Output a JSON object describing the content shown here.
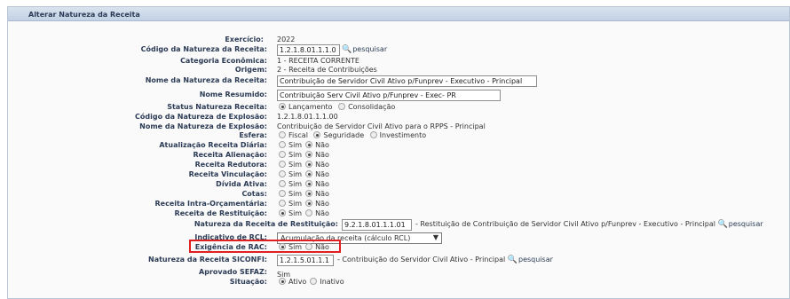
{
  "header": {
    "title": "Alterar Natureza da Receita"
  },
  "fields": {
    "exercicio": {
      "label": "Exercício:",
      "value": "2022"
    },
    "codigo": {
      "label": "Código da Natureza da Receita:",
      "value": "1.2.1.8.01.1.1.0",
      "search": "pesquisar"
    },
    "categoria": {
      "label": "Categoria Econômica:",
      "value": "1 -  RECEITA CORRENTE"
    },
    "origem": {
      "label": "Origem:",
      "value": "2 -  Receita de Contribuições"
    },
    "nome": {
      "label": "Nome da Natureza da Receita:",
      "value": "Contribuição de Servidor Civil Ativo p/Funprev - Executivo - Principal"
    },
    "nome_resumido": {
      "label": "Nome Resumido:",
      "value": "Contribuição Serv Civil Ativo p/Funprev - Exec- PR"
    },
    "status": {
      "label": "Status Natureza Receita:",
      "options": [
        "Lançamento",
        "Consolidação"
      ]
    },
    "cod_explosao": {
      "label": "Código da Natureza de Explosão:",
      "value": "1.2.1.8.01.1.1.00"
    },
    "nome_explosao": {
      "label": "Nome da Natureza de Explosão:",
      "value": "Contribuição de Servidor Civil Ativo para o RPPS - Principal"
    },
    "esfera": {
      "label": "Esfera:",
      "options": [
        "Fiscal",
        "Seguridade",
        "Investimento"
      ]
    },
    "atualizacao": {
      "label": "Atualização Receita Diária:"
    },
    "alienacao": {
      "label": "Receita Alienação:"
    },
    "redutora": {
      "label": "Receita Redutora:"
    },
    "vinculacao": {
      "label": "Receita Vinculação:"
    },
    "divida": {
      "label": "Dívida Ativa:"
    },
    "cotas": {
      "label": "Cotas:"
    },
    "intra": {
      "label": "Receita Intra-Orçamentária:"
    },
    "restituicao": {
      "label": "Receita de Restituição:"
    },
    "natureza_restituicao": {
      "label": "Natureza da Receita de Restituição:",
      "value": "9.2.1.8.01.1.1.01",
      "desc": "- Restituição de Contribuição de Servidor Civil Ativo p/Funprev - Executivo - Principal",
      "search": "pesquisar"
    },
    "indicativo_rcl": {
      "label": "Indicativo de RCL:",
      "value": "Acumulação da receita (cálculo RCL)"
    },
    "exigencia_rac": {
      "label": "Exigência de RAC:"
    },
    "siconfi": {
      "label": "Natureza da Receita SICONFI:",
      "value": "1.2.1.5.01.1.1",
      "desc": "- Contribuição do Servidor Civil Ativo - Principal",
      "search": "pesquisar"
    },
    "aprovado": {
      "label": "Aprovado SEFAZ:",
      "value": "Sim"
    },
    "situacao": {
      "label": "Situação:",
      "options": [
        "Ativo",
        "Inativo"
      ]
    }
  },
  "yesno": {
    "sim": "Sim",
    "nao": "Não"
  },
  "colors": {
    "header_bg": "#c3d1e3",
    "label": "#2b3b55",
    "highlight": "#e02020"
  }
}
